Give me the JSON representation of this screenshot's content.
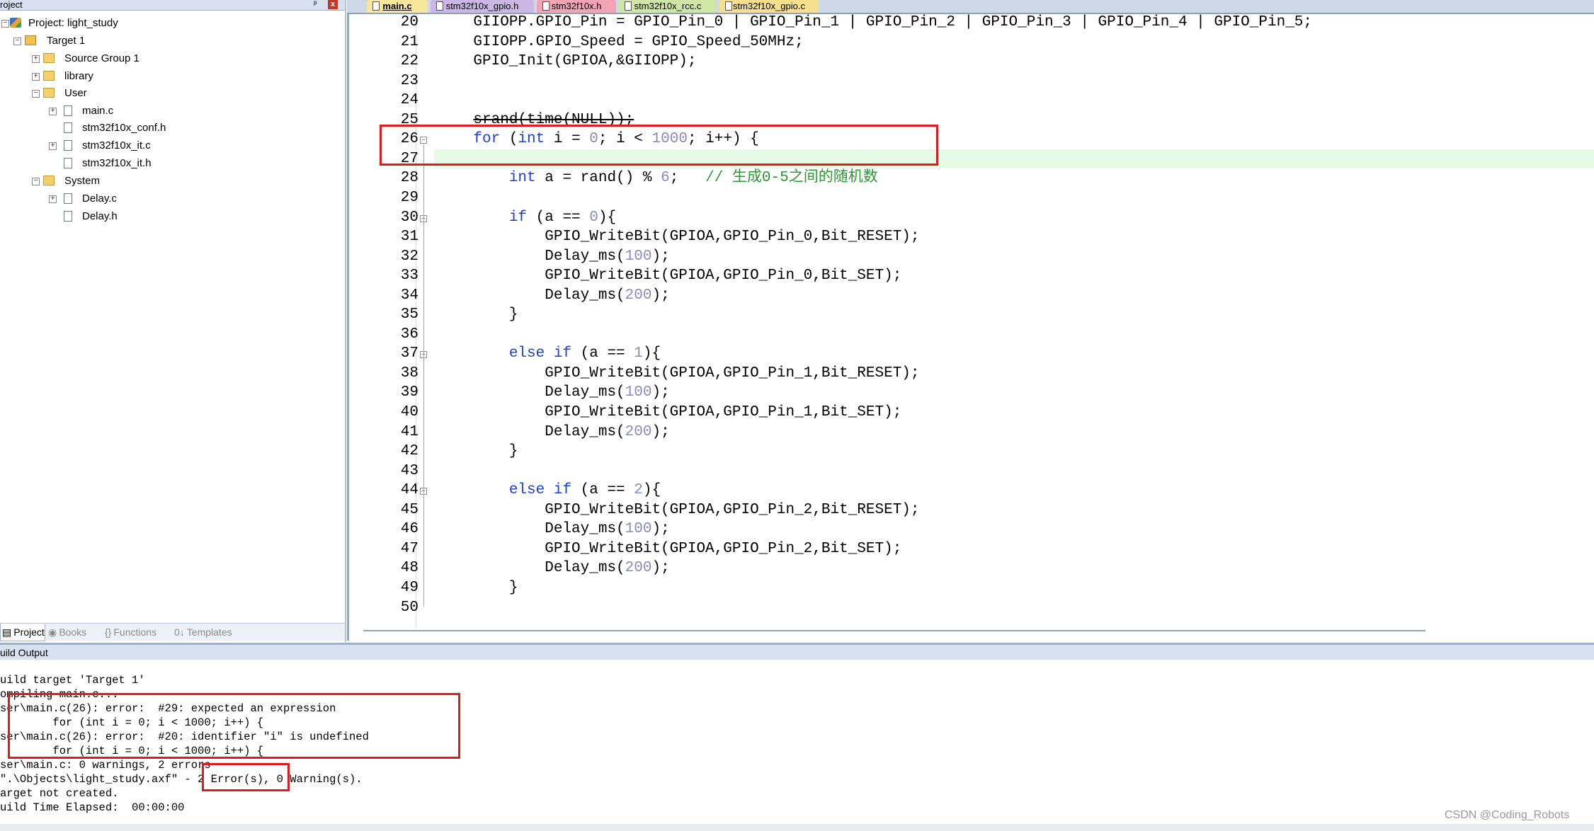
{
  "project_panel": {
    "title": "roject",
    "pin": "ᵖ",
    "close": "x",
    "tree": [
      {
        "label": "Project: light_study",
        "icon": "project-icon"
      },
      {
        "label": "Target 1",
        "icon": "target-icon"
      },
      {
        "label": "Source Group 1",
        "icon": "folder-icon"
      },
      {
        "label": "library",
        "icon": "folder-icon"
      },
      {
        "label": "User",
        "icon": "folder-icon"
      },
      {
        "label": "main.c",
        "icon": "file-icon"
      },
      {
        "label": "stm32f10x_conf.h",
        "icon": "file-icon"
      },
      {
        "label": "stm32f10x_it.c",
        "icon": "file-icon"
      },
      {
        "label": "stm32f10x_it.h",
        "icon": "file-icon"
      },
      {
        "label": "System",
        "icon": "folder-icon"
      },
      {
        "label": "Delay.c",
        "icon": "file-icon"
      },
      {
        "label": "Delay.h",
        "icon": "file-icon"
      }
    ],
    "tabs": [
      {
        "label": "Project",
        "glyph": "▤"
      },
      {
        "label": "Books",
        "glyph": "◉"
      },
      {
        "label": "Functions",
        "glyph": "{}"
      },
      {
        "label": "Templates",
        "glyph": "0↓"
      }
    ]
  },
  "editor": {
    "tabs": [
      {
        "label": "main.c",
        "color": "#f6e79a",
        "active": true
      },
      {
        "label": "stm32f10x_gpio.h",
        "color": "#cbb6e6"
      },
      {
        "label": "stm32f10x.h",
        "color": "#f3a3b3"
      },
      {
        "label": "stm32f10x_rcc.c",
        "color": "#cfe6a4"
      },
      {
        "label": "stm32f10x_gpio.c",
        "color": "#f6e08c"
      }
    ],
    "lines": [
      {
        "n": "20",
        "html": "    GIIOPP.GPIO_Pin = GPIO_Pin_0 | GPIO_Pin_1 | GPIO_Pin_2 | GPIO_Pin_3 | GPIO_Pin_4 | GPIO_Pin_5;"
      },
      {
        "n": "21",
        "html": "    GIIOPP.GPIO_Speed = GPIO_Speed_50MHz;"
      },
      {
        "n": "22",
        "html": "    GPIO_Init(GPIOA,&amp;GIIOPP);"
      },
      {
        "n": "23",
        "html": ""
      },
      {
        "n": "24",
        "html": ""
      },
      {
        "n": "25",
        "html": "    <span class=\"strike\">srand(time(NULL));</span>"
      },
      {
        "n": "26",
        "html": "    <span class=\"kw\">for</span> (<span class=\"kw\">int</span> i = <span class=\"num\">0</span>; i &lt; <span class=\"num\">1000</span>; i++) {"
      },
      {
        "n": "27",
        "html": ""
      },
      {
        "n": "28",
        "html": "        <span class=\"kw\">int</span> a = rand() % <span class=\"num\">6</span>;   <span class=\"cmt\">// 生成0-5之间的随机数</span>"
      },
      {
        "n": "29",
        "html": ""
      },
      {
        "n": "30",
        "html": "        <span class=\"kw\">if</span> (a == <span class=\"num\">0</span>){"
      },
      {
        "n": "31",
        "html": "            GPIO_WriteBit(GPIOA,GPIO_Pin_0,Bit_RESET);"
      },
      {
        "n": "32",
        "html": "            Delay_ms(<span class=\"num\">100</span>);"
      },
      {
        "n": "33",
        "html": "            GPIO_WriteBit(GPIOA,GPIO_Pin_0,Bit_SET);"
      },
      {
        "n": "34",
        "html": "            Delay_ms(<span class=\"num\">200</span>);"
      },
      {
        "n": "35",
        "html": "        }"
      },
      {
        "n": "36",
        "html": ""
      },
      {
        "n": "37",
        "html": "        <span class=\"kw\">else if</span> (a == <span class=\"num\">1</span>){"
      },
      {
        "n": "38",
        "html": "            GPIO_WriteBit(GPIOA,GPIO_Pin_1,Bit_RESET);"
      },
      {
        "n": "39",
        "html": "            Delay_ms(<span class=\"num\">100</span>);"
      },
      {
        "n": "40",
        "html": "            GPIO_WriteBit(GPIOA,GPIO_Pin_1,Bit_SET);"
      },
      {
        "n": "41",
        "html": "            Delay_ms(<span class=\"num\">200</span>);"
      },
      {
        "n": "42",
        "html": "        }"
      },
      {
        "n": "43",
        "html": ""
      },
      {
        "n": "44",
        "html": "        <span class=\"kw\">else if</span> (a == <span class=\"num\">2</span>){"
      },
      {
        "n": "45",
        "html": "            GPIO_WriteBit(GPIOA,GPIO_Pin_2,Bit_RESET);"
      },
      {
        "n": "46",
        "html": "            Delay_ms(<span class=\"num\">100</span>);"
      },
      {
        "n": "47",
        "html": "            GPIO_WriteBit(GPIOA,GPIO_Pin_2,Bit_SET);"
      },
      {
        "n": "48",
        "html": "            Delay_ms(<span class=\"num\">200</span>);"
      },
      {
        "n": "49",
        "html": "        }"
      },
      {
        "n": "50",
        "html": ""
      }
    ],
    "fold_lines": [
      "26",
      "30",
      "37",
      "44"
    ]
  },
  "output": {
    "title": "uild Output",
    "lines": [
      "uild target 'Target 1'",
      "ompiling main.c...",
      "ser\\main.c(26): error:  #29: expected an expression",
      "        for (int i = 0; i < 1000; i++) {",
      "ser\\main.c(26): error:  #20: identifier \"i\" is undefined",
      "        for (int i = 0; i < 1000; i++) {",
      "ser\\main.c: 0 warnings, 2 errors",
      "\".\\Objects\\light_study.axf\" - 2 Error(s), 0 Warning(s).",
      "arget not created.",
      "uild Time Elapsed:  00:00:00"
    ]
  },
  "watermark": "CSDN @Coding_Robots",
  "colors": {
    "accent_red": "#e01b1b",
    "keyword": "#1a3fd6",
    "number": "#8a8ac0",
    "comment": "#2a9a35",
    "current_line": "#e6fbe6"
  }
}
